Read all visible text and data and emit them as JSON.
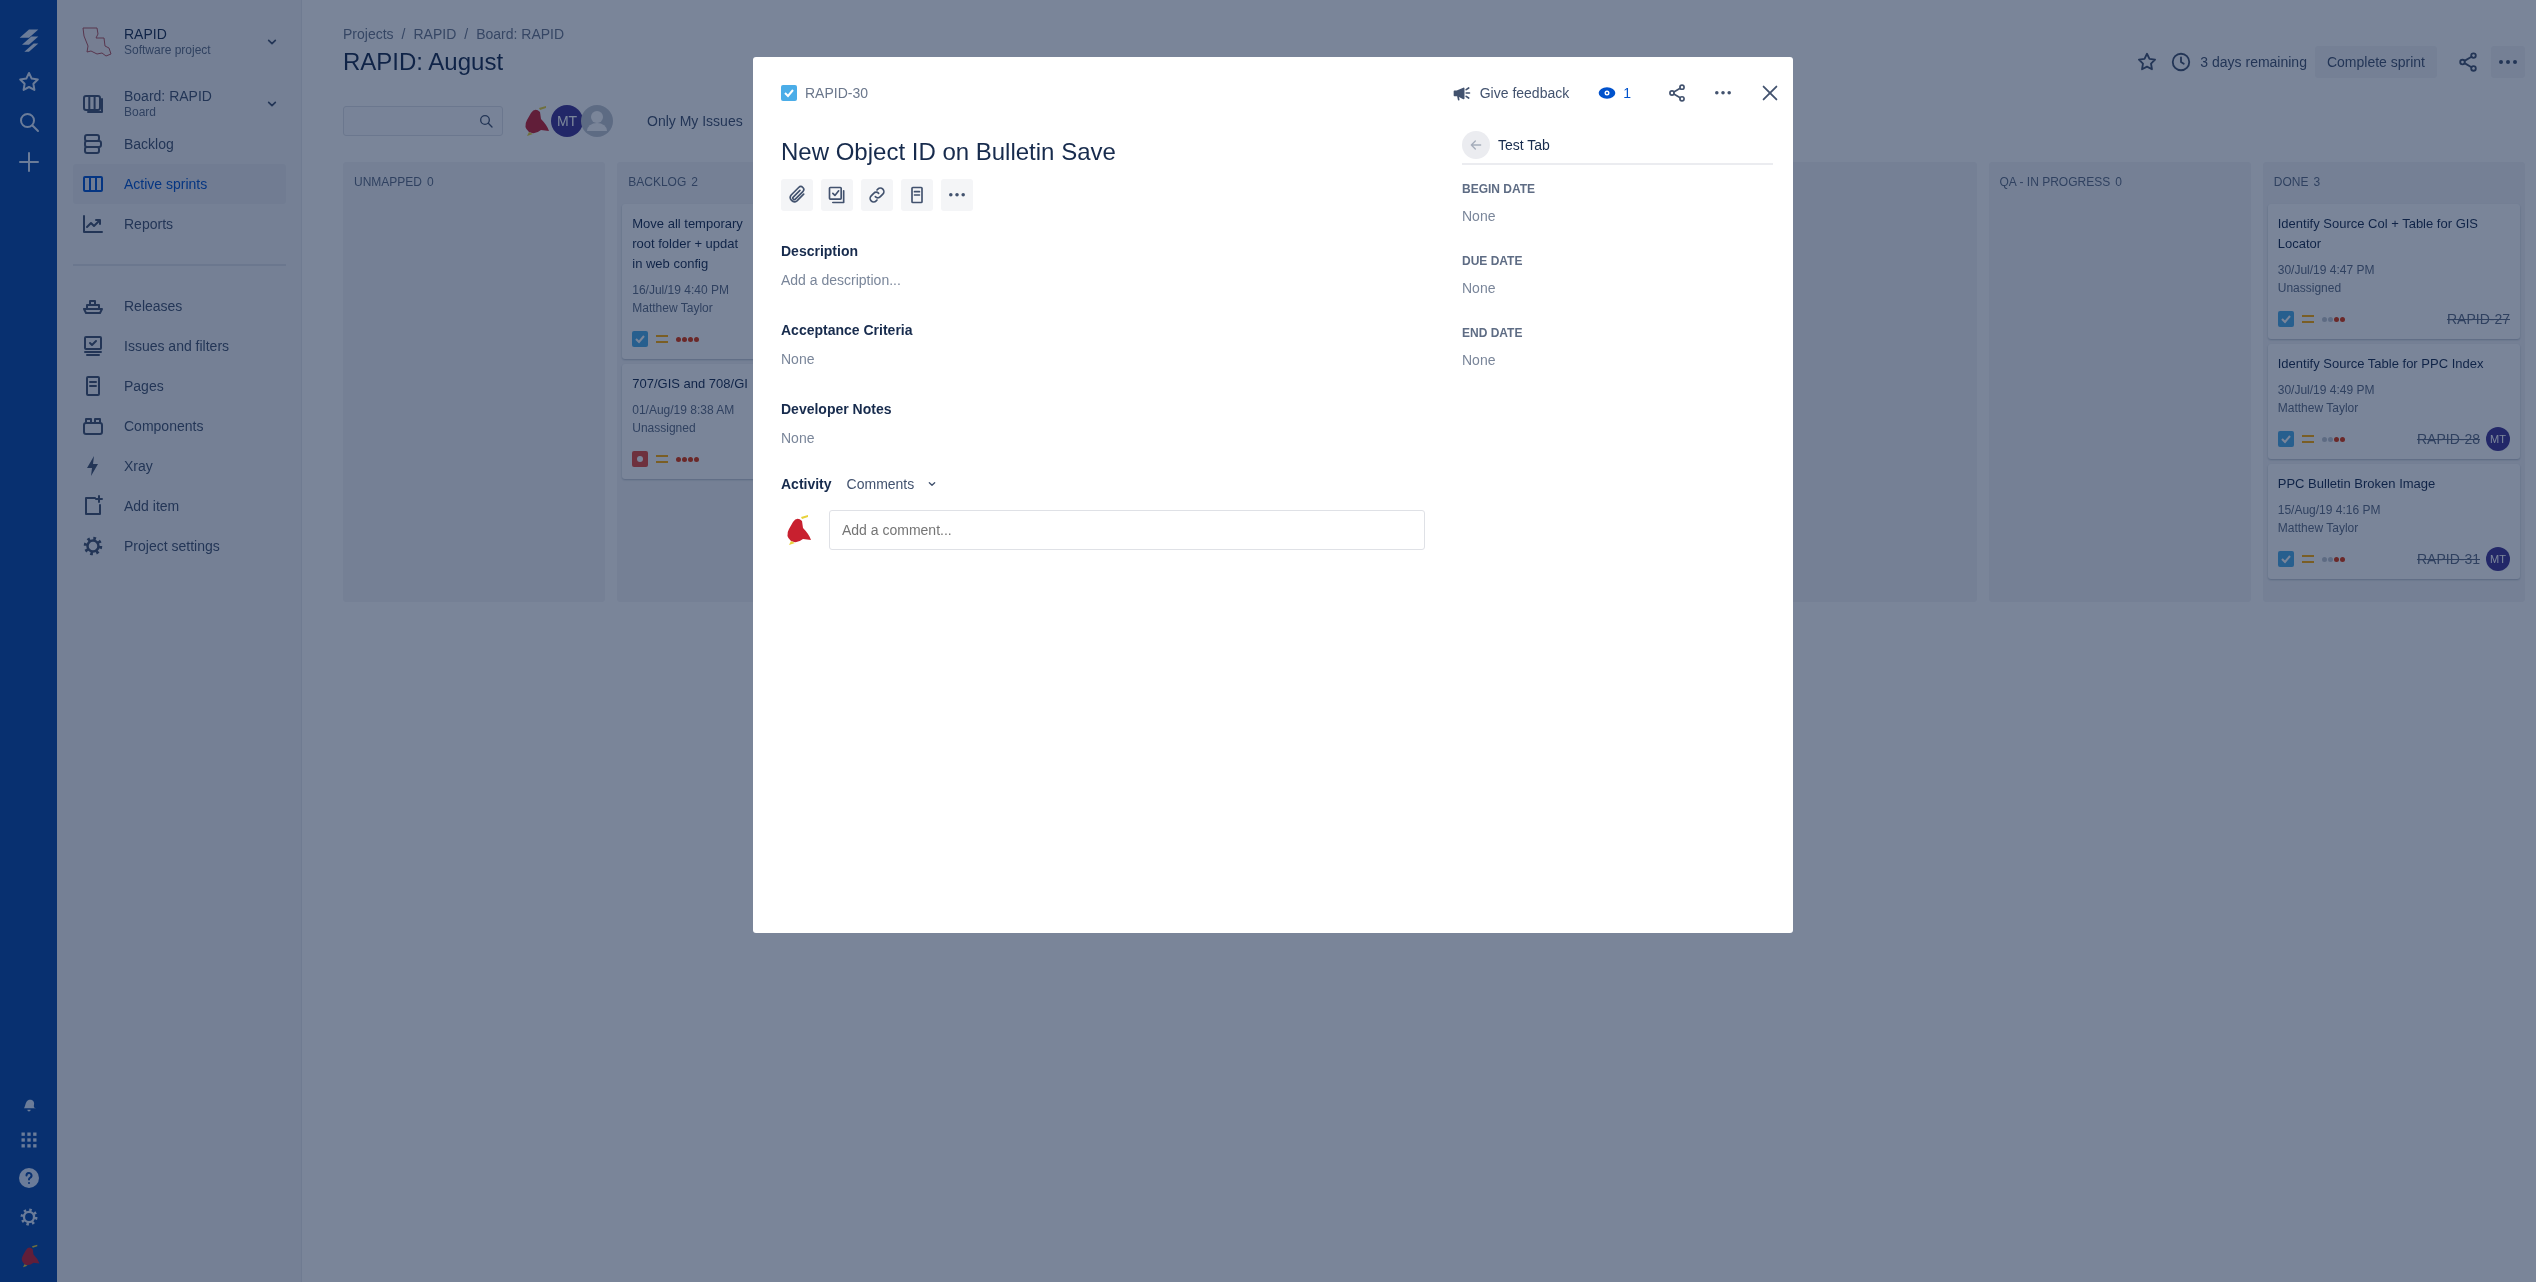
{
  "sidebar": {
    "project": {
      "name": "RAPID",
      "type": "Software project"
    },
    "board": {
      "name": "Board: RAPID",
      "type": "Board"
    },
    "sections": [
      {
        "items": [
          {
            "label": "Backlog",
            "selected": false
          },
          {
            "label": "Active sprints",
            "selected": true
          },
          {
            "label": "Reports",
            "selected": false
          }
        ]
      },
      {
        "items": [
          {
            "label": "Releases",
            "selected": false
          },
          {
            "label": "Issues and filters",
            "selected": false
          },
          {
            "label": "Pages",
            "selected": false
          },
          {
            "label": "Components",
            "selected": false
          },
          {
            "label": "Xray",
            "selected": false
          },
          {
            "label": "Add item",
            "selected": false
          },
          {
            "label": "Project settings",
            "selected": false
          }
        ]
      }
    ]
  },
  "header": {
    "breadcrumbs": [
      "Projects",
      "RAPID",
      "Board: RAPID"
    ],
    "breadcrumb_separator": "/",
    "title": "RAPID: August",
    "remaining": "3 days remaining",
    "complete_button": "Complete sprint"
  },
  "filters": {
    "avatars": [
      {
        "kind": "bird"
      },
      {
        "kind": "initials",
        "initials": "MT"
      },
      {
        "kind": "default"
      }
    ],
    "quick_filter": {
      "label": "Only My Issues",
      "selected": false
    }
  },
  "columns": [
    {
      "title": "UNMAPPED",
      "count": "0"
    },
    {
      "title": "BACKLOG",
      "count": "2",
      "cards": [
        {
          "title_lines": [
            "Move all temporary",
            "root folder + updat",
            "in web config"
          ],
          "date": "16/Jul/19 4:40 PM",
          "assignee": "Matthew Taylor",
          "kind": "story",
          "stars": 4
        },
        {
          "title_lines": [
            "707/GIS and 708/GI"
          ],
          "date": "01/Aug/19 8:38 AM",
          "assignee": "Unassigned",
          "kind": "bug",
          "stars": 4
        }
      ]
    },
    {
      "title": "QA - IN PROGRESS",
      "count": "0"
    },
    {
      "title": "DONE",
      "count": "3",
      "cards": [
        {
          "title_lines": [
            "Identify Source Col + Table for GIS",
            "Locator"
          ],
          "date": "30/Jul/19 4:47 PM",
          "assignee": "Unassigned",
          "kind": "story",
          "stars": 2,
          "key": "RAPID-27",
          "done": true
        },
        {
          "title_lines": [
            "Identify Source Table for PPC Index"
          ],
          "date": "30/Jul/19 4:49 PM",
          "assignee": "Matthew Taylor",
          "kind": "story",
          "stars": 2,
          "key": "RAPID-28",
          "done": true,
          "initials": "MT"
        },
        {
          "title_lines": [
            "PPC Bulletin Broken Image"
          ],
          "date": "15/Aug/19 4:16 PM",
          "assignee": "Matthew Taylor",
          "kind": "story",
          "stars": 2,
          "key": "RAPID-31",
          "done": true,
          "initials": "MT"
        }
      ]
    }
  ],
  "issue": {
    "key": "RAPID-30",
    "title": "New Object ID on Bulletin Save",
    "fields": [
      {
        "label": "Description",
        "value": "Add a description..."
      },
      {
        "label": "Acceptance Criteria",
        "value": "None"
      },
      {
        "label": "Developer Notes",
        "value": "None"
      }
    ],
    "activity": {
      "label": "Activity",
      "filter": "Comments",
      "comment_placeholder": "Add a comment..."
    },
    "feedback": "Give feedback",
    "watchers": "1",
    "tab": "Test Tab",
    "side_fields": [
      {
        "label": "BEGIN DATE",
        "value": "None"
      },
      {
        "label": "DUE DATE",
        "value": "None"
      },
      {
        "label": "END DATE",
        "value": "None"
      }
    ]
  }
}
